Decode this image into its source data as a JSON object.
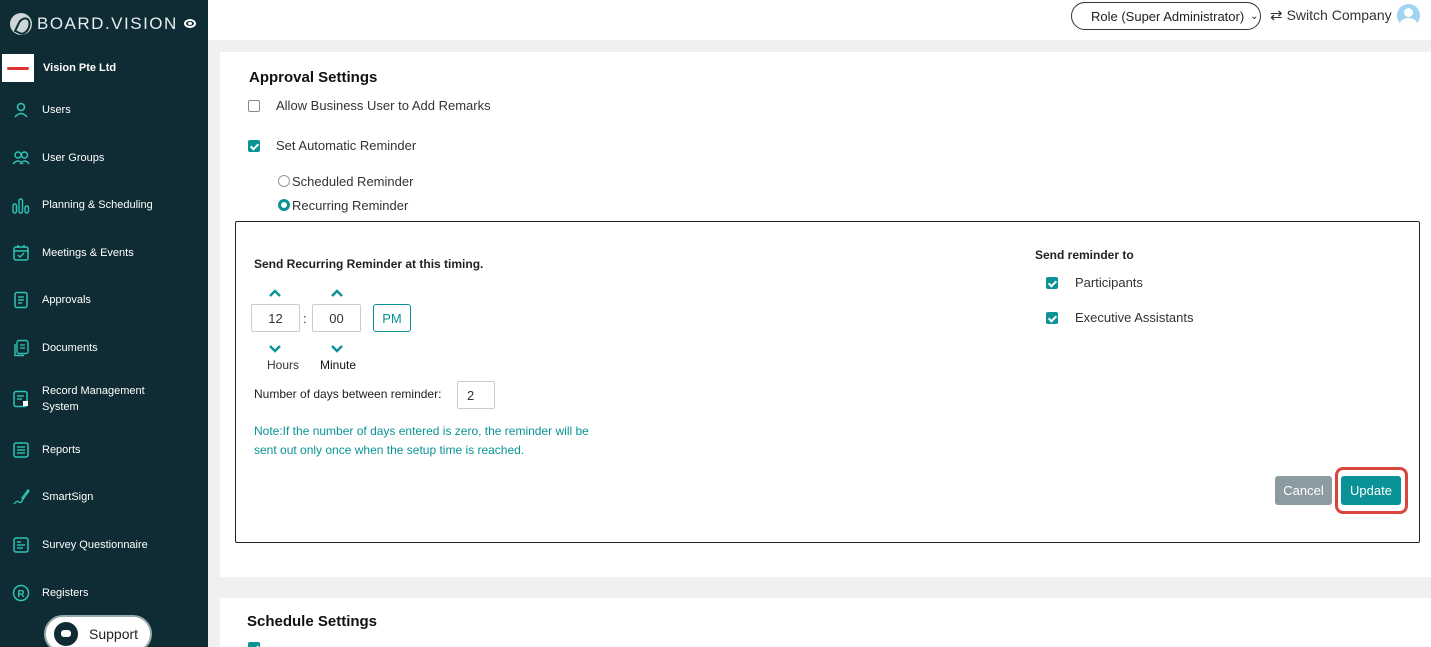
{
  "brand": {
    "name": "BOARD.VISION"
  },
  "company": {
    "name": "Vision Pte Ltd"
  },
  "sidebar": {
    "items": [
      {
        "label": "Users",
        "icon": "user-icon"
      },
      {
        "label": "User Groups",
        "icon": "user-group-icon"
      },
      {
        "label": "Planning & Scheduling",
        "icon": "bar-chart-icon"
      },
      {
        "label": "Meetings & Events",
        "icon": "calendar-icon"
      },
      {
        "label": "Approvals",
        "icon": "document-list-icon"
      },
      {
        "label": "Documents",
        "icon": "documents-icon"
      },
      {
        "label": "Record Management System",
        "icon": "record-management-icon"
      },
      {
        "label": "Reports",
        "icon": "report-icon"
      },
      {
        "label": "SmartSign",
        "icon": "signature-pen-icon"
      },
      {
        "label": "Survey Questionnaire",
        "icon": "survey-icon"
      },
      {
        "label": "Registers",
        "icon": "registered-icon"
      }
    ],
    "support_label": "Support"
  },
  "header": {
    "role_label": "Role (Super Administrator)",
    "switch_company_label": "Switch Company"
  },
  "approval": {
    "title": "Approval Settings",
    "allow_remarks_label": "Allow Business User to Add Remarks",
    "allow_remarks_checked": false,
    "auto_reminder_label": "Set Automatic Reminder",
    "auto_reminder_checked": true,
    "scheduled_label": "Scheduled Reminder",
    "recurring_label": "Recurring Reminder",
    "selected_reminder": "Recurring Reminder",
    "timing_title": "Send Recurring Reminder at this timing.",
    "hours_value": "12",
    "minutes_value": "00",
    "time_separator": ":",
    "ampm": "PM",
    "hours_label": "Hours",
    "minute_label": "Minute",
    "days_label": "Number of days between reminder:",
    "days_value": "2",
    "note": "Note:If the number of days entered is zero, the reminder will be sent out only once when the setup time is reached.",
    "send_to_title": "Send reminder to",
    "participants_label": "Participants",
    "participants_checked": true,
    "ea_label": "Executive Assistants",
    "ea_checked": true,
    "cancel_label": "Cancel",
    "update_label": "Update"
  },
  "schedule": {
    "title": "Schedule Settings"
  },
  "colors": {
    "sidebar_bg": "#0f2b33",
    "accent": "#0a9396",
    "highlight": "#d9463c"
  }
}
